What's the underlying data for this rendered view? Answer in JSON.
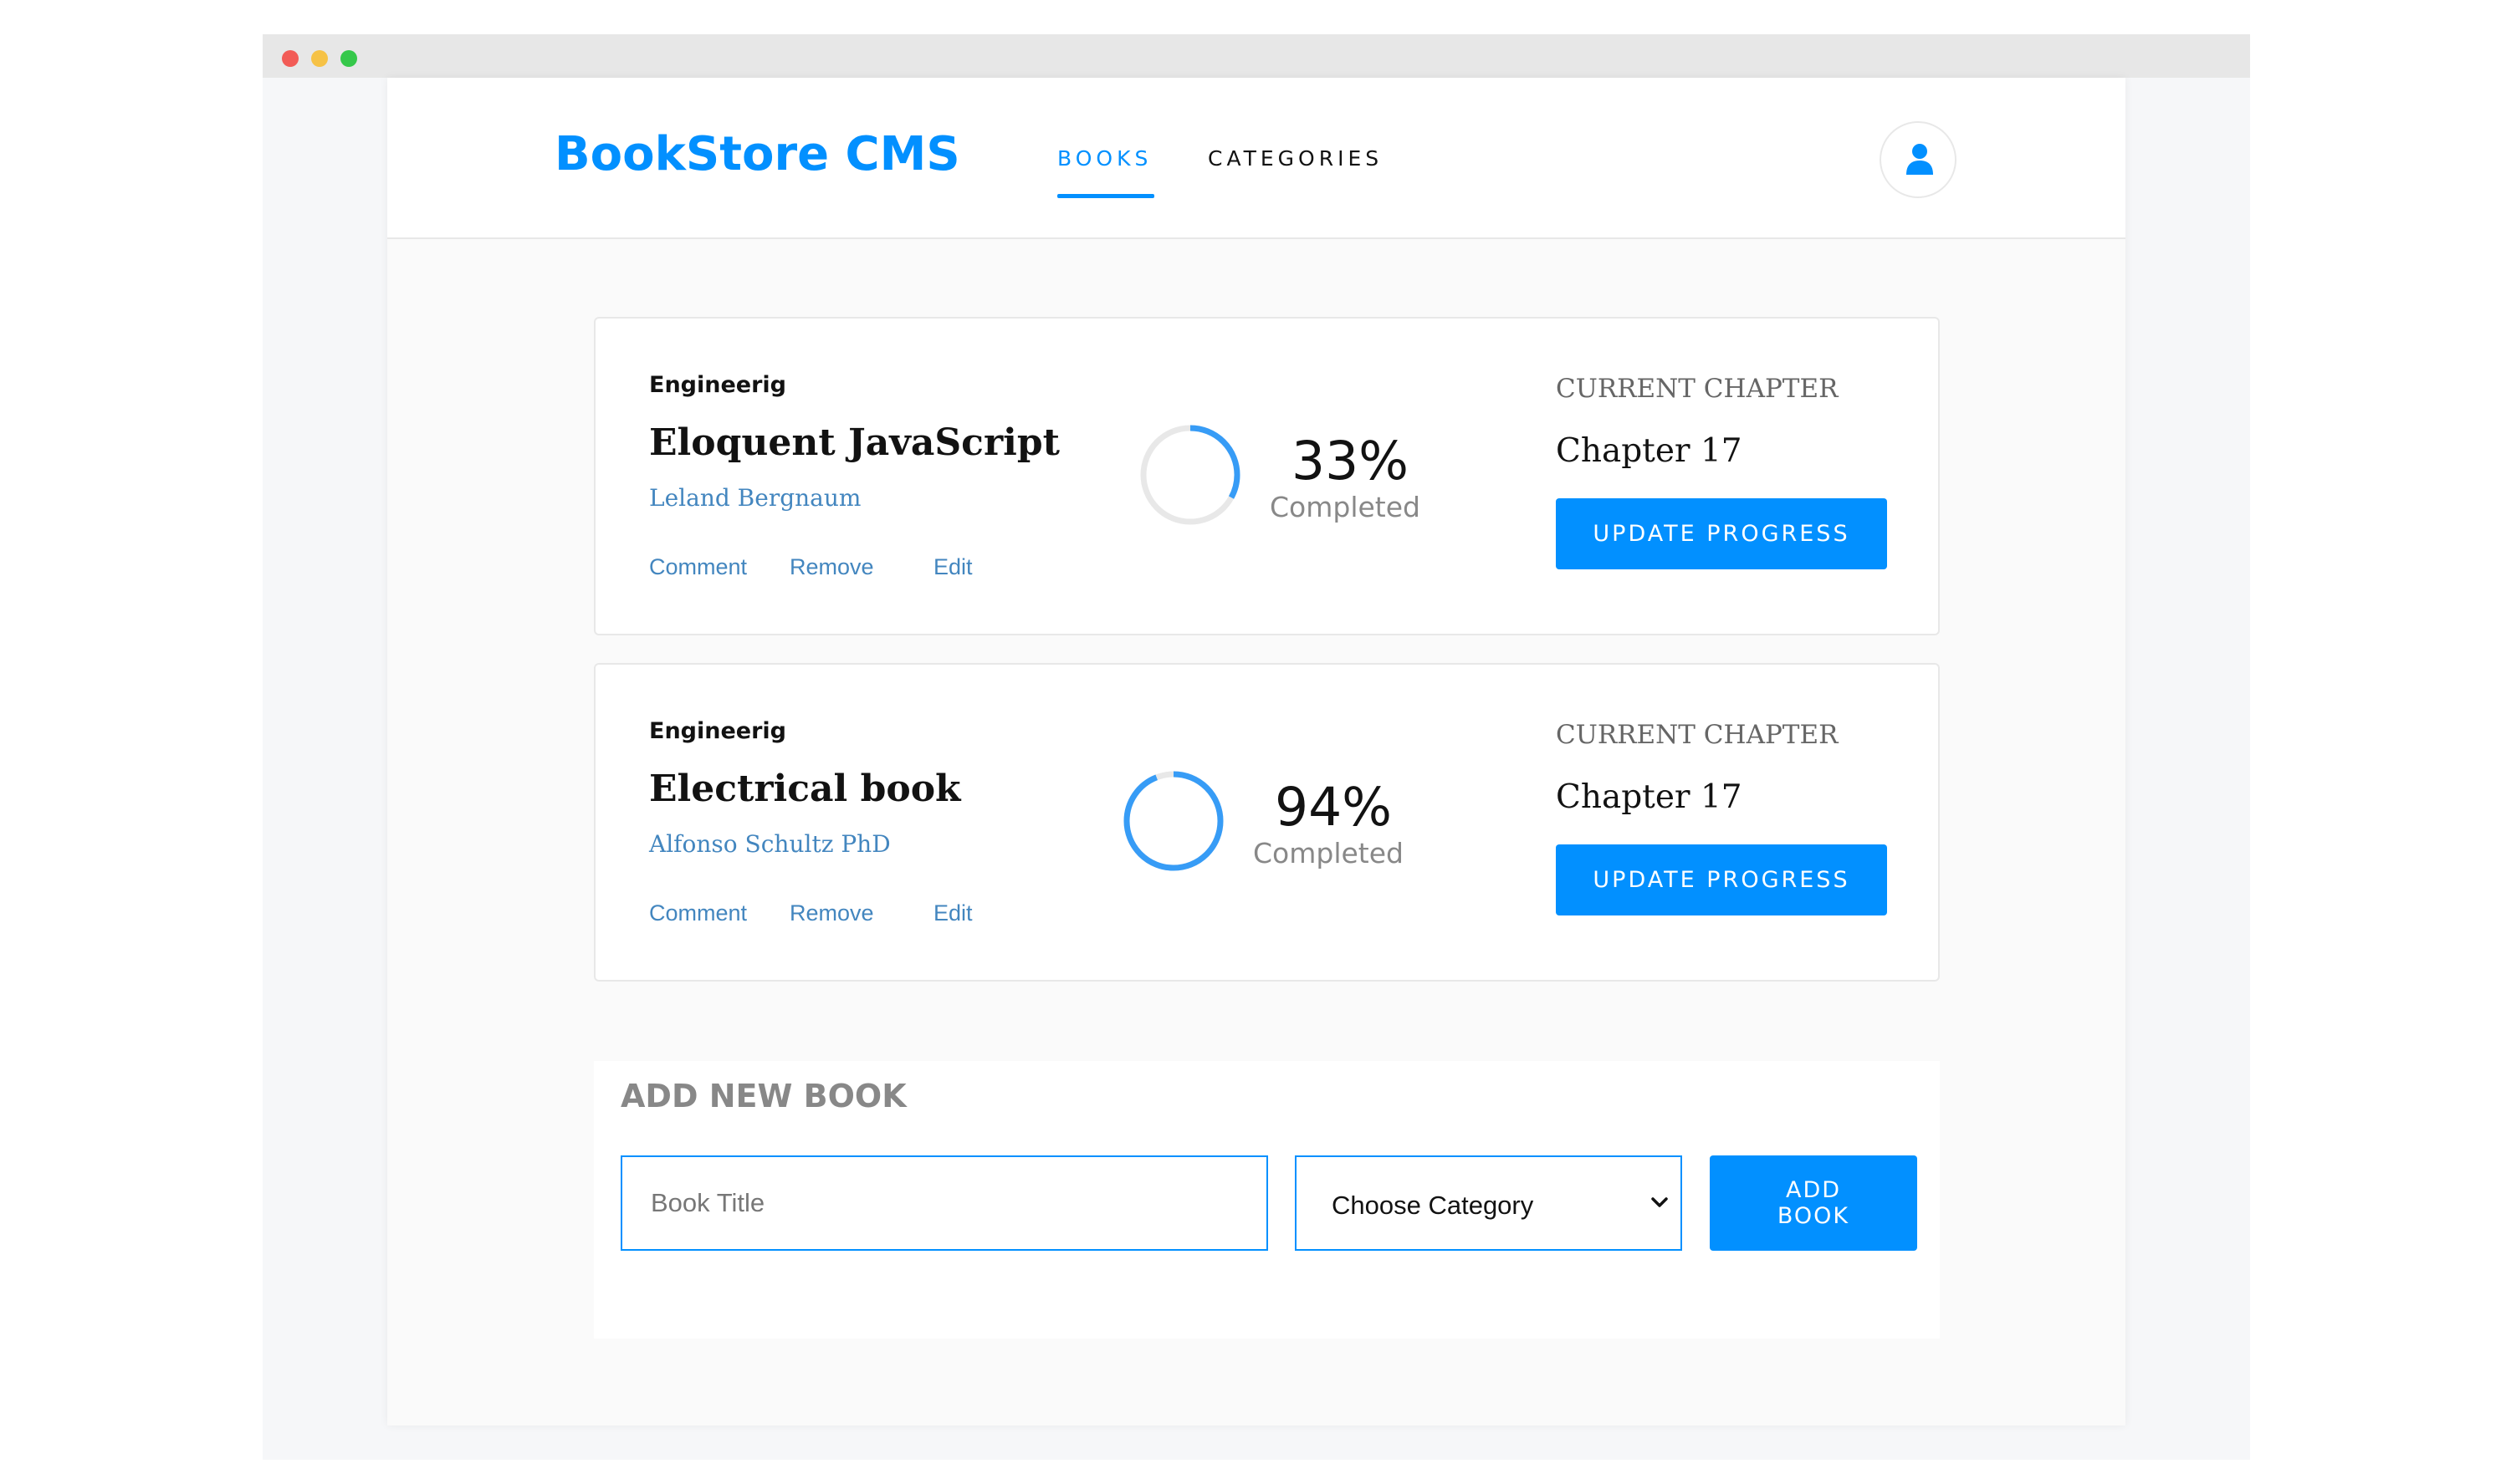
{
  "app": {
    "brand": "BookStore CMS"
  },
  "nav": {
    "books": "BOOKS",
    "categories": "CATEGORIES"
  },
  "books": [
    {
      "category": "Engineerig",
      "title": "Eloquent JavaScript",
      "author": "Leland Bergnaum",
      "actions": {
        "comment": "Comment",
        "remove": "Remove",
        "edit": "Edit"
      },
      "progress_percent": 33,
      "percent_label": "33%",
      "completed_label": "Completed",
      "chapter_label": "CURRENT CHAPTER",
      "chapter": "Chapter 17",
      "update_label": "UPDATE PROGRESS"
    },
    {
      "category": "Engineerig",
      "title": "Electrical book",
      "author": "Alfonso Schultz PhD",
      "actions": {
        "comment": "Comment",
        "remove": "Remove",
        "edit": "Edit"
      },
      "progress_percent": 94,
      "percent_label": "94%",
      "completed_label": "Completed",
      "chapter_label": "CURRENT CHAPTER",
      "chapter": "Chapter 17",
      "update_label": "UPDATE PROGRESS"
    }
  ],
  "add_book": {
    "title": "ADD NEW BOOK",
    "title_placeholder": "Book Title",
    "category_selected": "Choose Category",
    "button_line1": "ADD",
    "button_line2": "BOOK"
  },
  "colors": {
    "accent": "#0290ff",
    "link": "#4386bf",
    "ring_progress": "#379cf6",
    "ring_track": "#e8e8e8"
  },
  "icons": {
    "user": "user-icon",
    "dropdown": "chevron-down-icon"
  }
}
